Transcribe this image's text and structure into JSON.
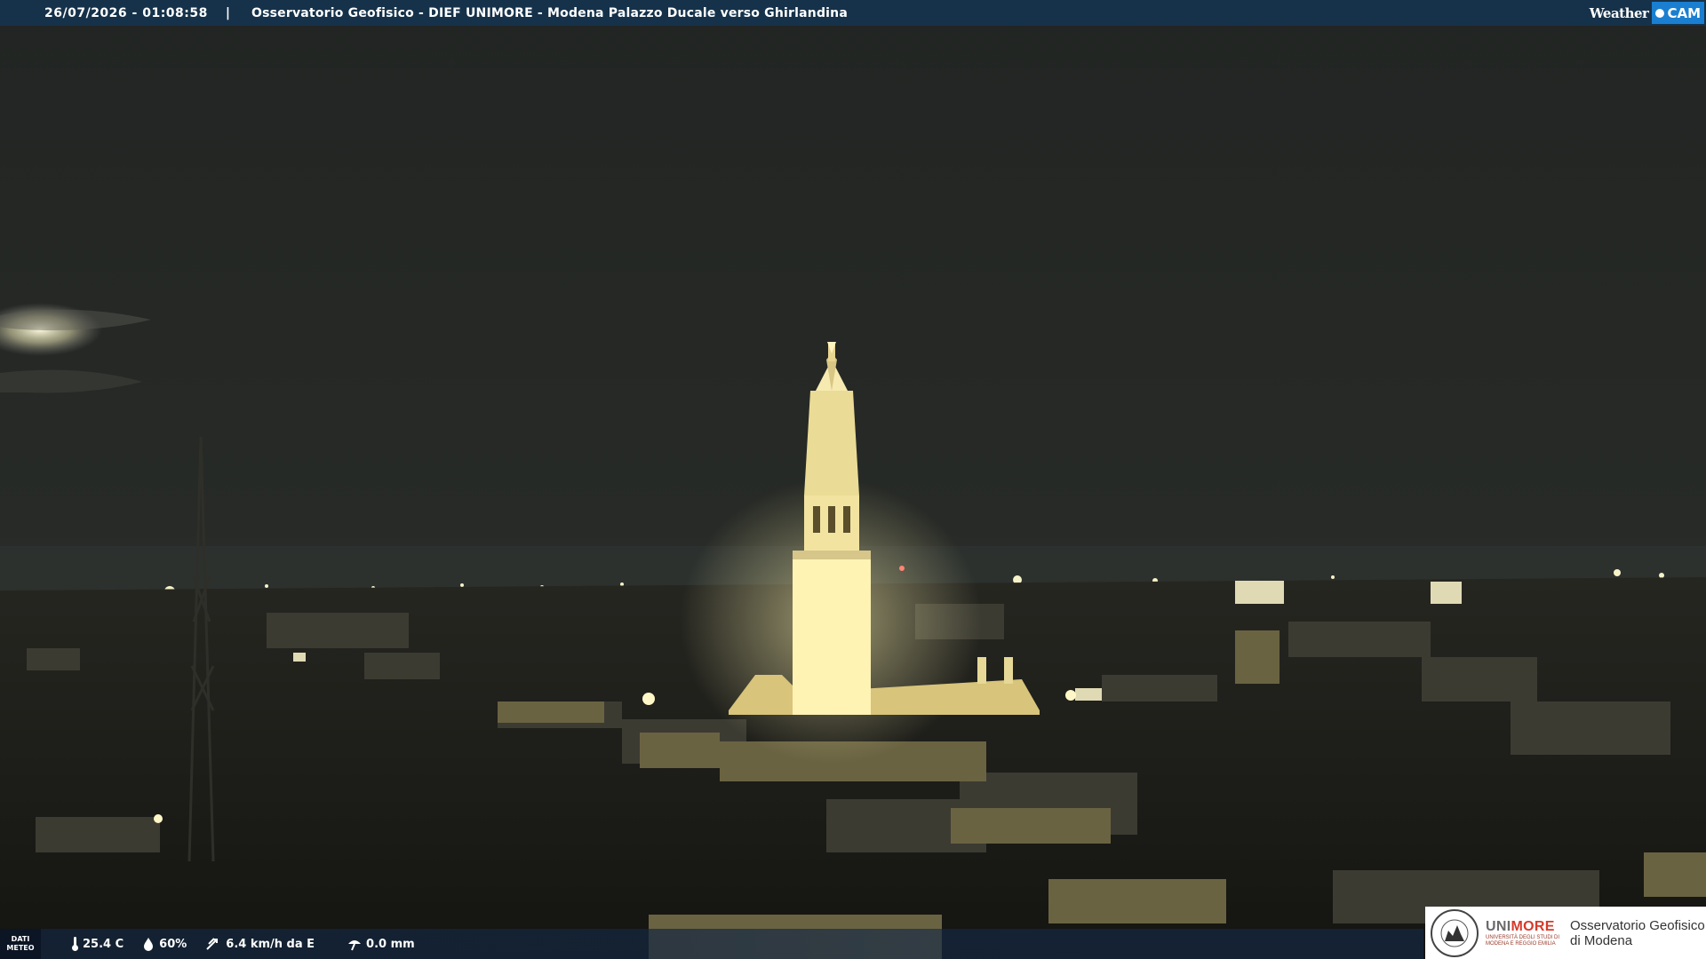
{
  "topbar": {
    "datetime": "26/07/2026 - 01:08:58",
    "separator": "|",
    "title": "Osservatorio Geofisico - DIEF UNIMORE - Modena Palazzo Ducale verso Ghirlandina"
  },
  "brand": {
    "weather": "Weather",
    "cam": "CAM"
  },
  "meteo": {
    "label_line1": "DATI",
    "label_line2": "METEO",
    "temperature": "25.4 C",
    "humidity": "60%",
    "wind": "6.4 km/h da E",
    "rain": "0.0 mm"
  },
  "logo": {
    "uni_prefix": "UNI",
    "uni_suffix": "MORE",
    "uni_sub1": "UNIVERSITÀ DEGLI STUDI DI",
    "uni_sub2": "MODENA E REGGIO EMILIA",
    "obs_line1": "Osservatorio Geofisico",
    "obs_line2": "di Modena"
  },
  "colors": {
    "bar": "#16324a",
    "accent": "#1a7fd0",
    "tower_light": "#fff6c0"
  },
  "icons": [
    "thermometer-icon",
    "droplet-icon",
    "wind-icon",
    "rain-icon"
  ]
}
